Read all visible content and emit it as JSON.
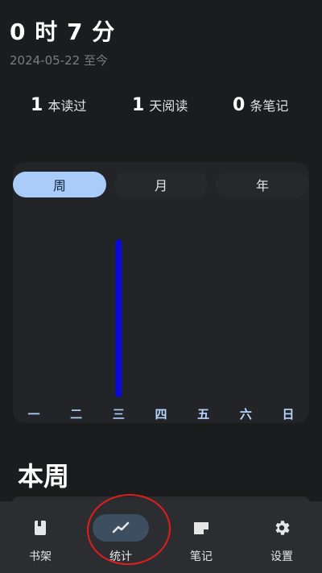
{
  "header": {
    "total_time": "0 时 7 分",
    "since": "2024-05-22 至今"
  },
  "stats": [
    {
      "num": "1",
      "label": "本读过"
    },
    {
      "num": "1",
      "label": "天阅读"
    },
    {
      "num": "0",
      "label": "条笔记"
    }
  ],
  "periods": {
    "week": "周",
    "month": "月",
    "year": "年",
    "selected": "周"
  },
  "chart_data": {
    "type": "bar",
    "categories": [
      "一",
      "二",
      "三",
      "四",
      "五",
      "六",
      "日"
    ],
    "values": [
      0,
      0,
      7,
      0,
      0,
      0,
      0
    ],
    "highlight_color": "#0a0ad8",
    "label_dim_color": "#a9cdf8"
  },
  "section": {
    "title": "本周"
  },
  "nav": {
    "items": [
      {
        "label": "书架",
        "icon": "book-icon"
      },
      {
        "label": "统计",
        "icon": "trending-icon"
      },
      {
        "label": "笔记",
        "icon": "note-icon"
      },
      {
        "label": "设置",
        "icon": "gear-icon"
      }
    ],
    "active": "统计"
  },
  "colors": {
    "background": "#1b1c1e",
    "card": "#222428",
    "accent": "#a9cdf8",
    "annotation": "#e11d1d"
  }
}
